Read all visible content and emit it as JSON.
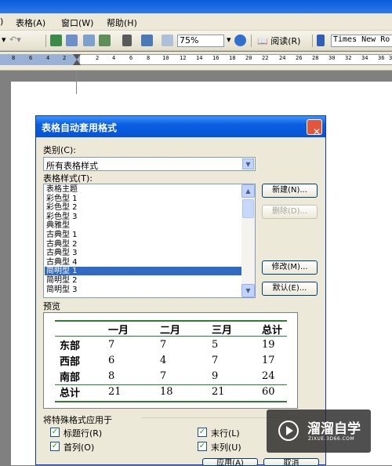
{
  "menu": [
    "表格(A)",
    "窗口(W)",
    "帮助(H)"
  ],
  "menu_partial_left": ")",
  "toolbar": {
    "zoom": "75%",
    "read_label": "阅读(R)",
    "font_name": "Times New Ro"
  },
  "ruler_ticks": [
    "8",
    "6",
    "4",
    "2",
    "2",
    "4",
    "6",
    "8",
    "10",
    "12",
    "14",
    "16",
    "18",
    "20",
    "22",
    "24",
    "26",
    "28",
    "30",
    "32",
    "34",
    "36",
    "3"
  ],
  "dialog": {
    "title": "表格自动套用格式",
    "category_label": "类别(C):",
    "category_value": "所有表格样式",
    "style_label": "表格样式(T):",
    "styles": [
      "表格主题",
      "彩色型 1",
      "彩色型 2",
      "彩色型 3",
      "典雅型",
      "古典型 1",
      "古典型 2",
      "古典型 3",
      "古典型 4",
      "简明型 1",
      "简明型 2",
      "简明型 3"
    ],
    "selected_style": "简明型 1",
    "buttons": {
      "new": "新建(N)...",
      "delete": "删除(D)...",
      "modify": "修改(M)...",
      "default": "默认(E)...",
      "apply": "应用(A)",
      "cancel": "取消"
    },
    "preview_label": "预览",
    "preview": {
      "header": [
        "",
        "一月",
        "二月",
        "三月",
        "总计"
      ],
      "rows": [
        [
          "东部",
          "7",
          "7",
          "5",
          "19"
        ],
        [
          "西部",
          "6",
          "4",
          "7",
          "17"
        ],
        [
          "南部",
          "8",
          "7",
          "9",
          "24"
        ],
        [
          "总计",
          "21",
          "18",
          "21",
          "60"
        ]
      ]
    },
    "apply_group_label": "将特殊格式应用于",
    "checks": {
      "header_row": "标题行(R)",
      "first_col": "首列(O)",
      "last_row": "末行(L)",
      "last_col": "末列(U)"
    }
  },
  "watermark": {
    "brand": "溜溜自学",
    "url": "ZIXUE.3D66.COM"
  }
}
